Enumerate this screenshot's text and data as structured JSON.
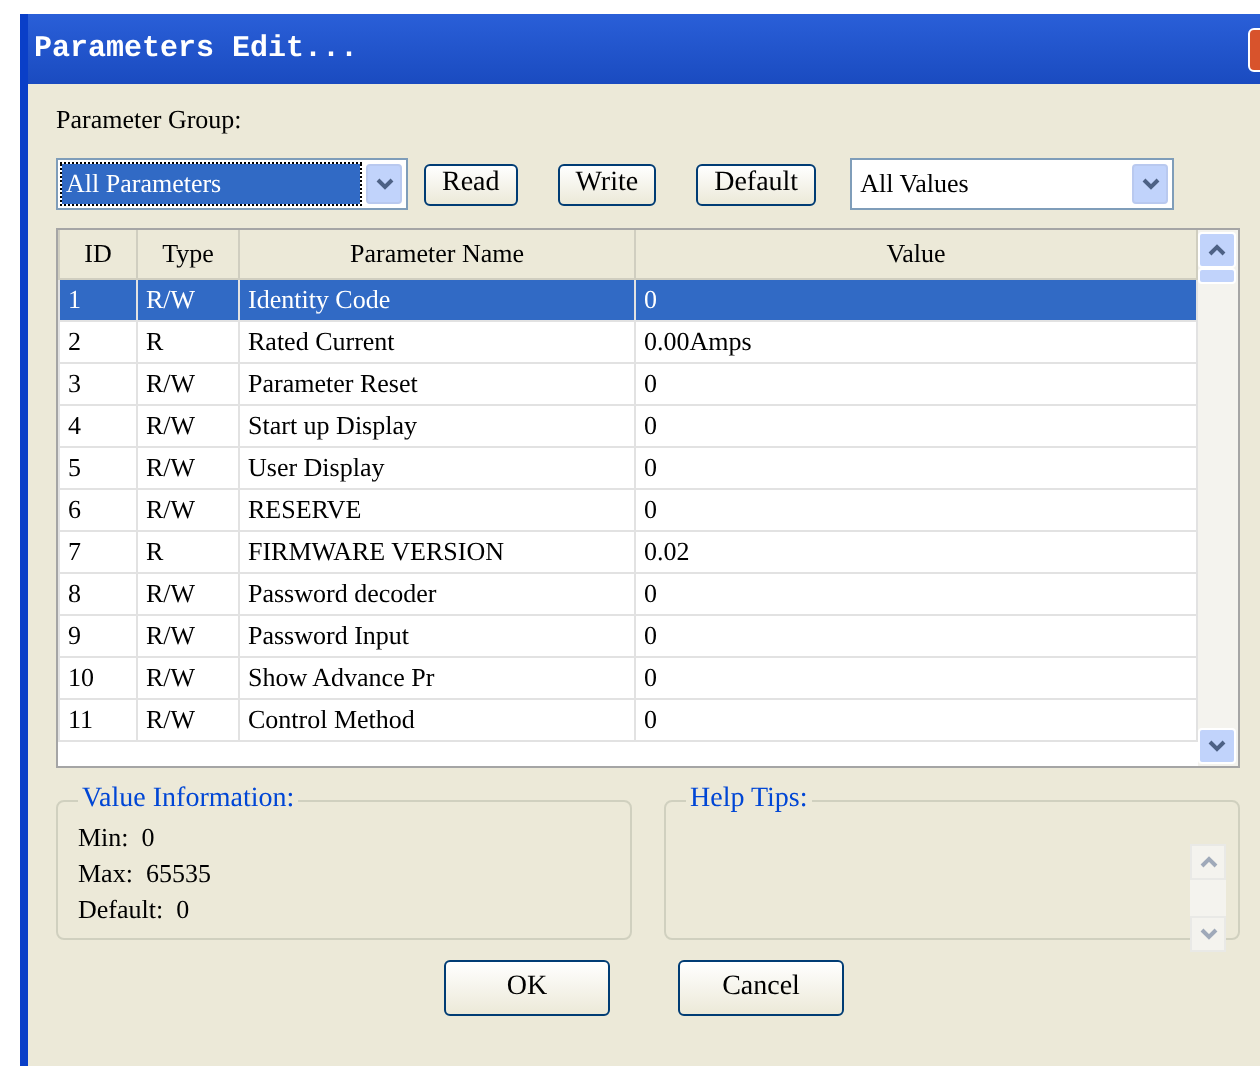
{
  "window": {
    "title": "Parameters Edit..."
  },
  "group_label": "Parameter Group:",
  "group_combo": {
    "value": "All Parameters"
  },
  "buttons": [
    "Read",
    "Write",
    "Default"
  ],
  "values_combo": {
    "value": "All Values"
  },
  "table": {
    "columns": [
      "ID",
      "Type",
      "Parameter Name",
      "Value"
    ],
    "rows": [
      {
        "cells": [
          "1",
          "R/W",
          "Identity Code",
          "0"
        ],
        "selected": true
      },
      {
        "cells": [
          "2",
          "R",
          "Rated Current",
          "0.00Amps"
        ],
        "selected": false
      },
      {
        "cells": [
          "3",
          "R/W",
          "Parameter Reset",
          "0"
        ],
        "selected": false
      },
      {
        "cells": [
          "4",
          "R/W",
          "Start up Display",
          "0"
        ],
        "selected": false
      },
      {
        "cells": [
          "5",
          "R/W",
          "User Display",
          "0"
        ],
        "selected": false
      },
      {
        "cells": [
          "6",
          "R/W",
          "RESERVE",
          "0"
        ],
        "selected": false
      },
      {
        "cells": [
          "7",
          "R",
          "FIRMWARE VERSION",
          "0.02"
        ],
        "selected": false
      },
      {
        "cells": [
          "8",
          "R/W",
          "Password decoder",
          "0"
        ],
        "selected": false
      },
      {
        "cells": [
          "9",
          "R/W",
          "Password Input",
          "0"
        ],
        "selected": false
      },
      {
        "cells": [
          "10",
          "R/W",
          "Show Advance Pr",
          "0"
        ],
        "selected": false
      },
      {
        "cells": [
          "11",
          "R/W",
          "Control Method",
          "0"
        ],
        "selected": false
      }
    ]
  },
  "value_info": {
    "title": "Value Information:",
    "lines": [
      "Min:  0",
      "Max:  65535",
      "Default:  0"
    ]
  },
  "help_tips": {
    "title": "Help Tips:"
  },
  "dialog_buttons": [
    "OK",
    "Cancel"
  ]
}
